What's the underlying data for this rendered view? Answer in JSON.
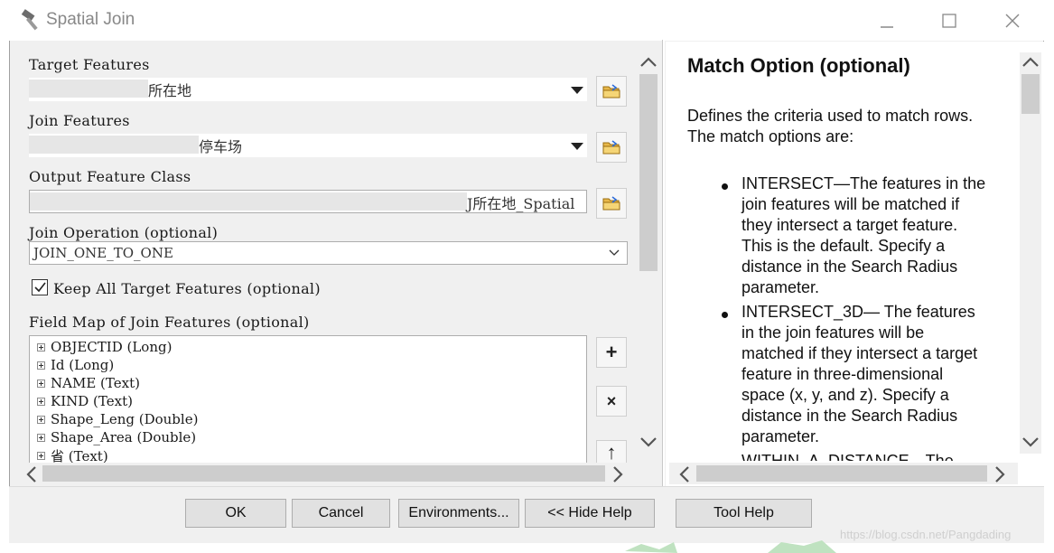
{
  "window": {
    "title": "Spatial Join",
    "controls": [
      "minimize-icon",
      "maximize-icon",
      "close-icon"
    ]
  },
  "form": {
    "target_features": {
      "label": "Target Features",
      "value": "所在地"
    },
    "join_features": {
      "label": "Join Features",
      "value": "停车场"
    },
    "output_feature_class": {
      "label": "Output Feature Class",
      "value": "J所在地_Spatial"
    },
    "join_operation": {
      "label": "Join Operation (optional)",
      "value": "JOIN_ONE_TO_ONE"
    },
    "keep_all": {
      "label": "Keep All Target Features (optional)",
      "checked": true
    },
    "field_map": {
      "label": "Field Map of Join Features (optional)",
      "items": [
        "OBJECTID (Long)",
        "Id (Long)",
        "NAME (Text)",
        "KIND (Text)",
        "Shape_Leng (Double)",
        "Shape_Area (Double)",
        "省 (Text)"
      ],
      "buttons": [
        "+",
        "×",
        "↑"
      ]
    }
  },
  "help": {
    "title": "Match Option (optional)",
    "intro": [
      "Defines the criteria used to match rows.",
      "The match options are:"
    ],
    "bullets": [
      [
        "INTERSECT—The features in the",
        "join features will be matched if",
        "they intersect a target feature.",
        "This is the default. Specify a",
        "distance in the Search Radius",
        "parameter."
      ],
      [
        "INTERSECT_3D— The features",
        "in the join features will be",
        "matched if they intersect a target",
        "feature in three-dimensional",
        "space (x, y, and z). Specify a",
        "distance in the Search Radius",
        "parameter."
      ],
      [
        "WITHIN_A_DISTANCE—The"
      ]
    ]
  },
  "buttons": {
    "ok": "OK",
    "cancel": "Cancel",
    "environments": "Environments...",
    "hide_help": "<< Hide Help",
    "tool_help": "Tool Help"
  },
  "watermark": "https://blog.csdn.net/Pangdading"
}
